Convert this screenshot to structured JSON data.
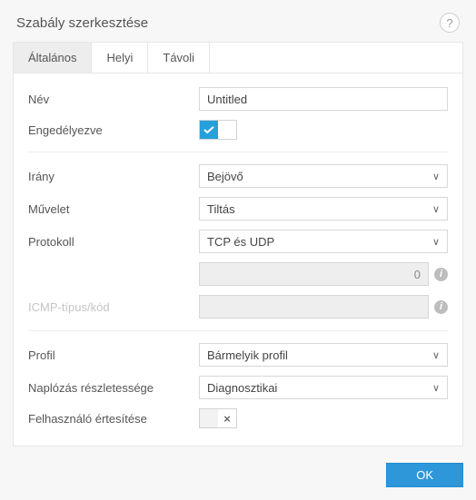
{
  "header": {
    "title": "Szabály szerkesztése"
  },
  "tabs": {
    "general": "Általános",
    "local": "Helyi",
    "remote": "Távoli",
    "active": 0
  },
  "fields": {
    "name": {
      "label": "Név",
      "value": "Untitled"
    },
    "enabled": {
      "label": "Engedélyezve",
      "on": true
    },
    "direction": {
      "label": "Irány",
      "value": "Bejövő"
    },
    "action": {
      "label": "Művelet",
      "value": "Tiltás"
    },
    "protocol": {
      "label": "Protokoll",
      "value": "TCP és UDP"
    },
    "protocolnum": {
      "value": "0"
    },
    "icmp": {
      "label": "ICMP-típus/kód",
      "value": ""
    },
    "profile": {
      "label": "Profil",
      "value": "Bármelyik profil"
    },
    "logging": {
      "label": "Naplózás részletessége",
      "value": "Diagnosztikai"
    },
    "notify": {
      "label": "Felhasználó értesítése",
      "on": false
    }
  },
  "footer": {
    "ok": "OK"
  }
}
